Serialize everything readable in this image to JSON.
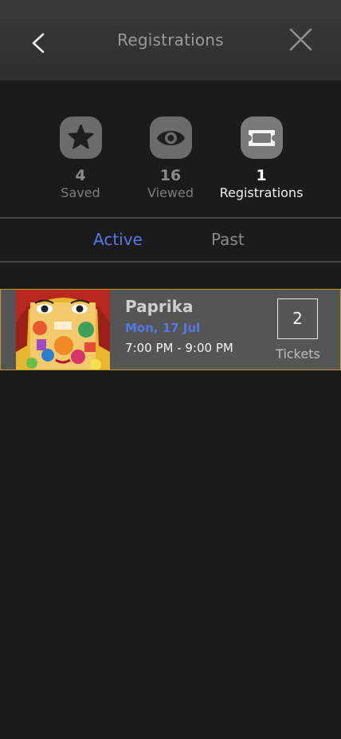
{
  "header": {
    "title": "Registrations",
    "back_icon": "chevron-left-icon",
    "close_icon": "close-icon"
  },
  "stats": {
    "saved": {
      "count": "4",
      "label": "Saved",
      "icon": "star-icon"
    },
    "viewed": {
      "count": "16",
      "label": "Viewed",
      "icon": "eye-icon"
    },
    "registrations": {
      "count": "1",
      "label": "Registrations",
      "icon": "ticket-icon"
    }
  },
  "tabs": {
    "active_label": "Active",
    "past_label": "Past",
    "selected": "Active"
  },
  "registrations": [
    {
      "name": "Paprika",
      "date": "Mon, 17 Jul",
      "time": "7:00 PM - 9:00 PM",
      "tickets": "2",
      "tickets_label": "Tickets"
    }
  ],
  "colors": {
    "accent": "#5479e6",
    "card_border": "#c79a22",
    "background": "#1b1b1b",
    "card_background": "#555555"
  }
}
